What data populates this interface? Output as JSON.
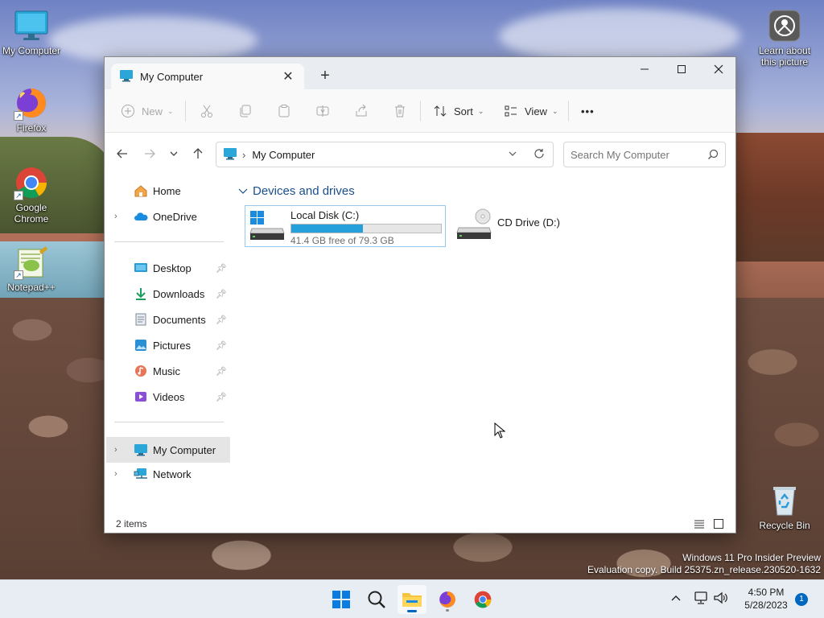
{
  "desktop": {
    "icons": [
      {
        "label": "My Computer",
        "icon": "monitor-icon"
      },
      {
        "label": "Firefox",
        "icon": "firefox-icon"
      },
      {
        "label": "Google Chrome",
        "icon": "chrome-icon"
      },
      {
        "label": "Notepad++",
        "icon": "notepadpp-icon"
      },
      {
        "label": "Learn about this picture",
        "icon": "camera-info-icon"
      },
      {
        "label": "Recycle Bin",
        "icon": "recycle-bin-icon"
      }
    ],
    "watermark_line1": "Windows 11 Pro Insider Preview",
    "watermark_line2": "Evaluation copy. Build 25375.zn_release.230520-1632"
  },
  "window": {
    "tab_title": "My Computer",
    "controls": {
      "minimize": "minimize-icon",
      "maximize": "maximize-icon",
      "close": "close-icon"
    },
    "commandbar": {
      "new_label": "New",
      "sort_label": "Sort",
      "view_label": "View",
      "more_label": "•••"
    },
    "address": {
      "path": "My Computer",
      "search_placeholder": "Search My Computer"
    },
    "nav": {
      "quick": [
        {
          "label": "Home",
          "icon": "home-icon"
        },
        {
          "label": "OneDrive",
          "icon": "onedrive-icon"
        }
      ],
      "pinned": [
        {
          "label": "Desktop",
          "icon": "desktop-folder-icon"
        },
        {
          "label": "Downloads",
          "icon": "downloads-icon"
        },
        {
          "label": "Documents",
          "icon": "documents-icon"
        },
        {
          "label": "Pictures",
          "icon": "pictures-icon"
        },
        {
          "label": "Music",
          "icon": "music-icon"
        },
        {
          "label": "Videos",
          "icon": "videos-icon"
        }
      ],
      "locations": [
        {
          "label": "My Computer",
          "icon": "monitor-icon"
        },
        {
          "label": "Network",
          "icon": "network-icon"
        }
      ]
    },
    "content": {
      "group_title": "Devices and drives",
      "drives": [
        {
          "name": "Local Disk (C:)",
          "free_text": "41.4 GB free of 79.3 GB",
          "used_fraction": 0.478
        },
        {
          "name": "CD Drive (D:)"
        }
      ]
    },
    "status": {
      "item_count": "2 items"
    }
  },
  "taskbar": {
    "time": "4:50 PM",
    "date": "5/28/2023",
    "notification_count": "1"
  },
  "colors": {
    "accent": "#0067c0",
    "progress": "#26a0da",
    "group_header": "#1a4f8b"
  }
}
